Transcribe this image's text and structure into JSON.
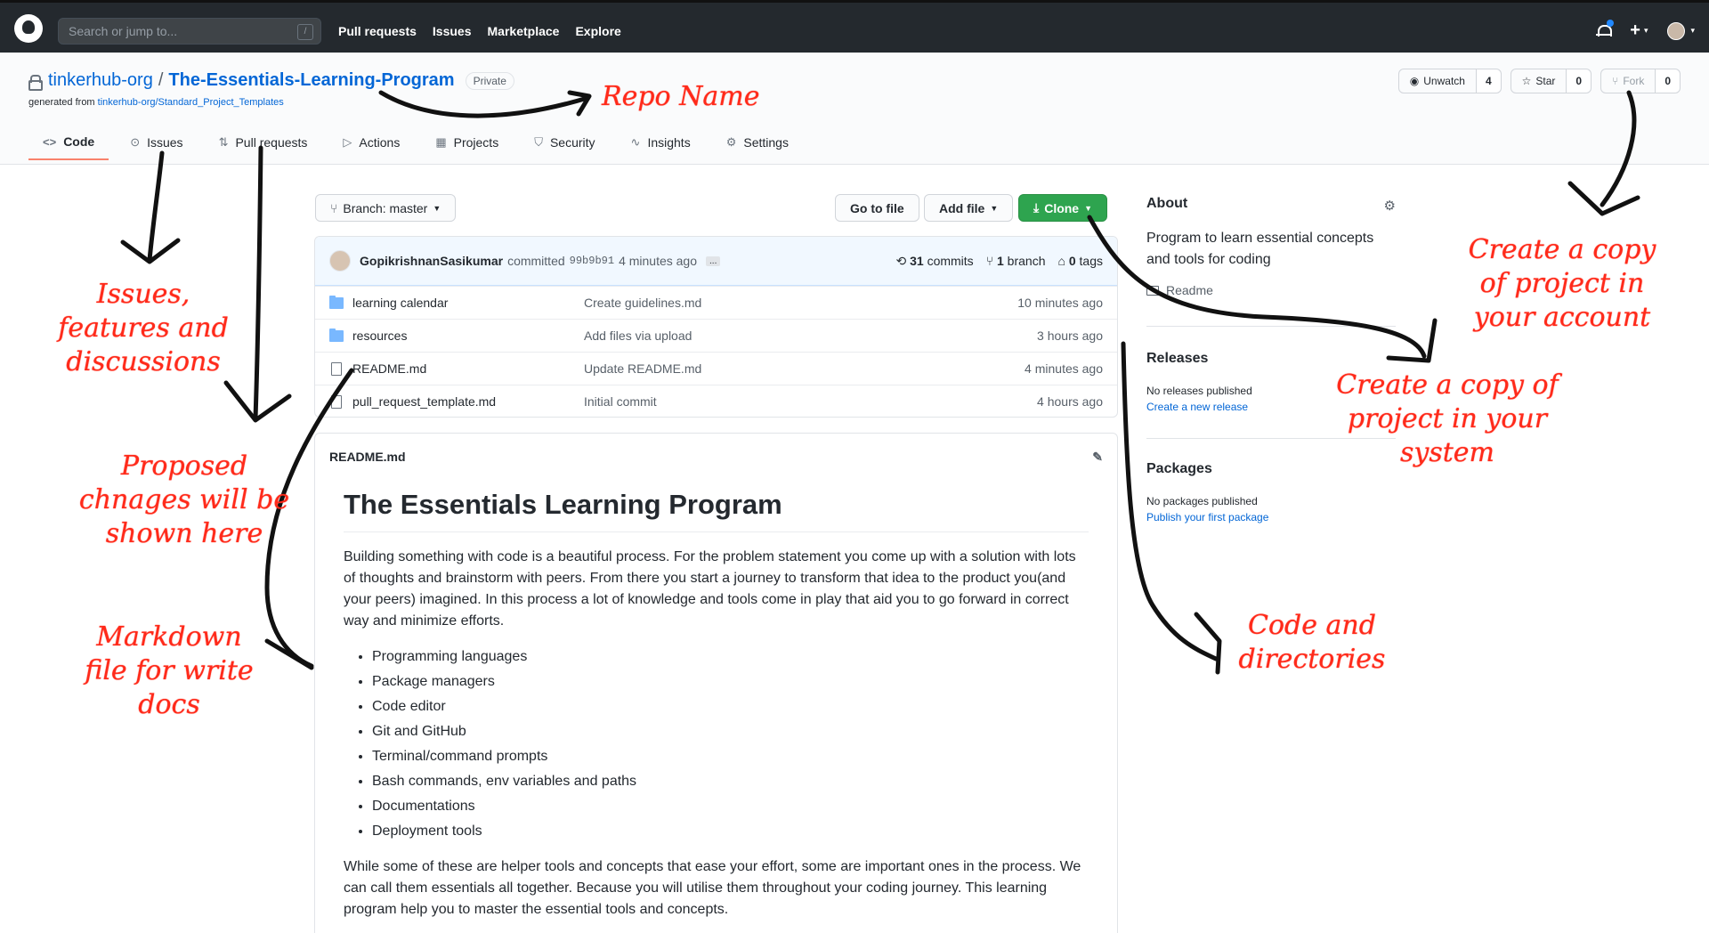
{
  "header": {
    "search_placeholder": "Search or jump to...",
    "search_shortcut": "/",
    "nav": [
      "Pull requests",
      "Issues",
      "Marketplace",
      "Explore"
    ],
    "plus": "+",
    "caret": "▾"
  },
  "repo": {
    "owner": "tinkerhub-org",
    "separator": "/",
    "name": "The-Essentials-Learning-Program",
    "visibility": "Private",
    "generated_prefix": "generated from ",
    "generated_link": "tinkerhub-org/Standard_Project_Templates",
    "watch_label": "Unwatch",
    "watch_count": "4",
    "star_label": "Star",
    "star_count": "0",
    "fork_label": "Fork",
    "fork_count": "0",
    "tabs": [
      "Code",
      "Issues",
      "Pull requests",
      "Actions",
      "Projects",
      "Security",
      "Insights",
      "Settings"
    ],
    "tab_icons": [
      "<>",
      "⊙",
      "⇅",
      "▷",
      "▦",
      "⛉",
      "∿",
      "⚙"
    ]
  },
  "toolbar": {
    "branch_label": "Branch: master",
    "go_to_file": "Go to file",
    "add_file": "Add file",
    "clone": "Clone"
  },
  "commit": {
    "author": "GopikrishnanSasikumar",
    "action": "committed",
    "sha": "99b9b91",
    "age": "4 minutes ago",
    "ellipsis": "...",
    "commits_count": "31",
    "commits_label": "commits",
    "branch_count": "1",
    "branch_label": "branch",
    "tags_count": "0",
    "tags_label": "tags"
  },
  "files": [
    {
      "type": "folder",
      "name": "learning calendar",
      "message": "Create guidelines.md",
      "age": "10 minutes ago"
    },
    {
      "type": "folder",
      "name": "resources",
      "message": "Add files via upload",
      "age": "3 hours ago"
    },
    {
      "type": "file",
      "name": "README.md",
      "message": "Update README.md",
      "age": "4 minutes ago"
    },
    {
      "type": "file",
      "name": "pull_request_template.md",
      "message": "Initial commit",
      "age": "4 hours ago"
    }
  ],
  "readme": {
    "filename": "README.md",
    "title": "The Essentials Learning Program",
    "intro": "Building something with code is a beautiful process. For the problem statement you come up with a solution with lots of thoughts and brainstorm with peers. From there you start a journey to transform that idea to the product you(and your peers) imagined. In this process a lot of knowledge and tools come in play that aid you to go forward in correct way and minimize efforts.",
    "list": [
      "Programming languages",
      "Package managers",
      "Code editor",
      "Git and GitHub",
      "Terminal/command prompts",
      "Bash commands, env variables and paths",
      "Documentations",
      "Deployment tools"
    ],
    "outro": "While some of these are helper tools and concepts that ease your effort, some are important ones in the process. We can call them essentials all together. Because you will utilise them throughout your coding journey. This learning program help you to master the essential tools and concepts."
  },
  "sidebar": {
    "about_title": "About",
    "about_text": "Program to learn essential concepts and tools for coding",
    "readme_link": "Readme",
    "releases_title": "Releases",
    "releases_none": "No releases published",
    "releases_link": "Create a new release",
    "packages_title": "Packages",
    "packages_none": "No packages published",
    "packages_link": "Publish your first package"
  },
  "annotations": {
    "repo_name": "Repo Name",
    "issues": "Issues, features and discussions",
    "proposed": "Proposed chnages will be shown here",
    "markdown": "Markdown file for write docs",
    "fork": "Create a copy of project in your account",
    "clone": "Create a copy of project in your system",
    "code": "Code and directories"
  },
  "colors": {
    "header_bg": "#24292e",
    "link_blue": "#0366d6",
    "clone_green": "#2ea44f",
    "annotation_red": "#ff2a1a",
    "active_tab": "#f9826c"
  }
}
